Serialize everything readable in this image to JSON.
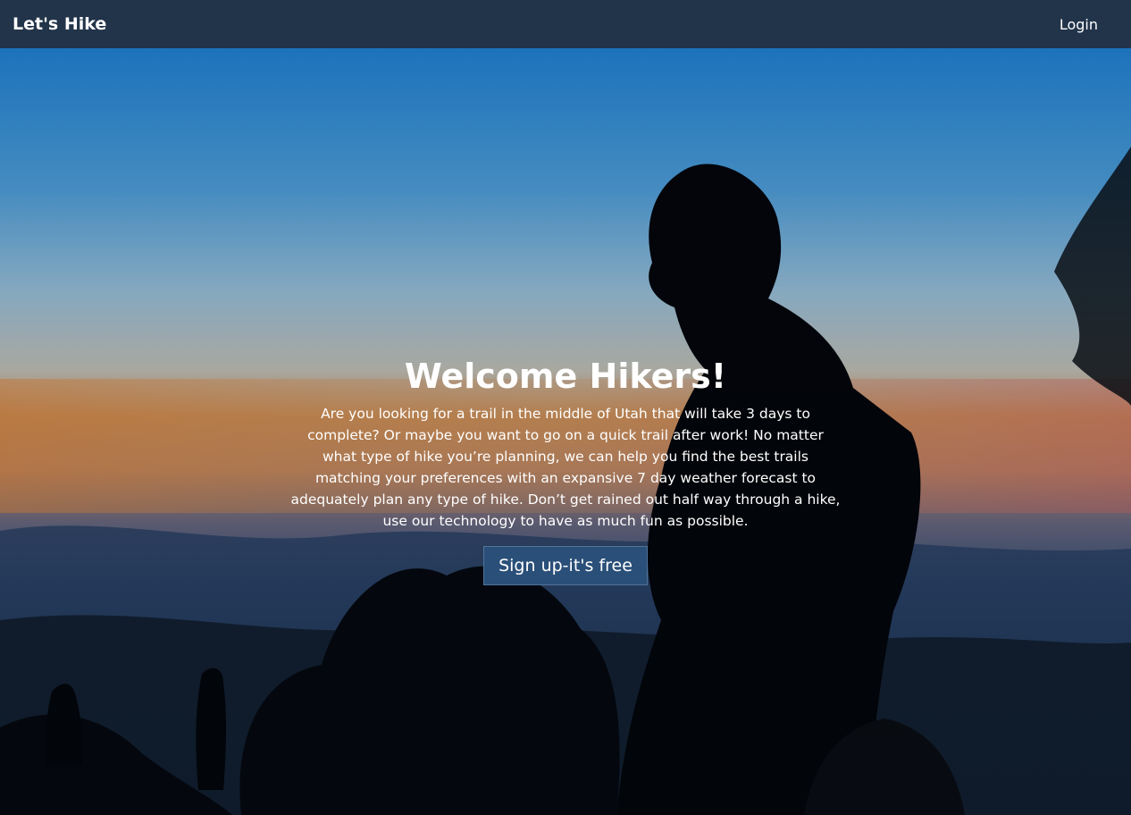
{
  "navbar": {
    "brand": "Let's Hike",
    "login_label": "Login",
    "background_color": "#22344a"
  },
  "hero": {
    "title": "Welcome Hikers!",
    "description": "Are you looking for a trail in the middle of Utah that will take 3 days to complete? Or maybe you want to go on a quick trail after work! No matter what type of hike you’re planning, we can help you find the best trails matching your preferences with an expansive 7 day weather forecast to adequately plan any type of hike. Don’t get rained out half way through a hike, use our technology to have as much fun as possible.",
    "cta_label": "Sign up-it's free",
    "cta_color": "#2a4f78"
  }
}
